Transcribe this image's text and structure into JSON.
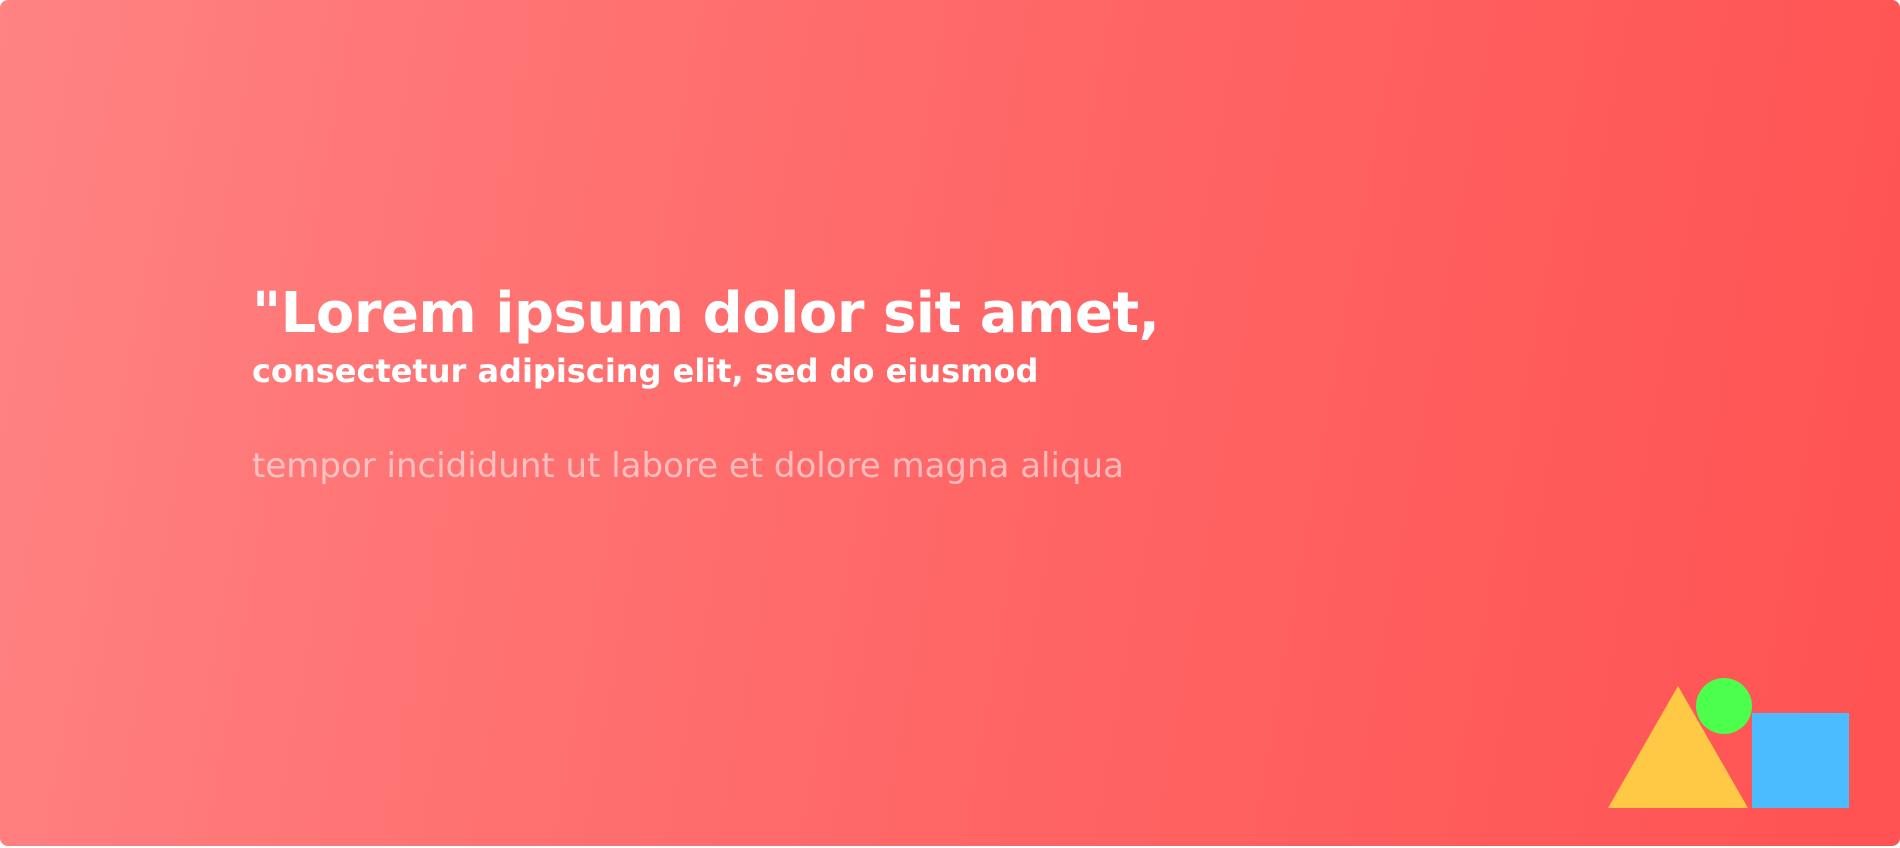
{
  "quote": {
    "title": "\"Lorem ipsum dolor sit amet,",
    "subtitle": "consectetur adipiscing elit, sed do eiusmod",
    "body": "tempor incididunt ut labore et dolore magna aliqua"
  },
  "logo": {
    "icon": "shapes-icon",
    "colors": {
      "triangle": "#ffc845",
      "circle": "#4cff4c",
      "square": "#4bbcff"
    }
  },
  "colors": {
    "gradient_start": "#ff8383",
    "gradient_end": "#ff5252",
    "text": "#ffffff"
  }
}
